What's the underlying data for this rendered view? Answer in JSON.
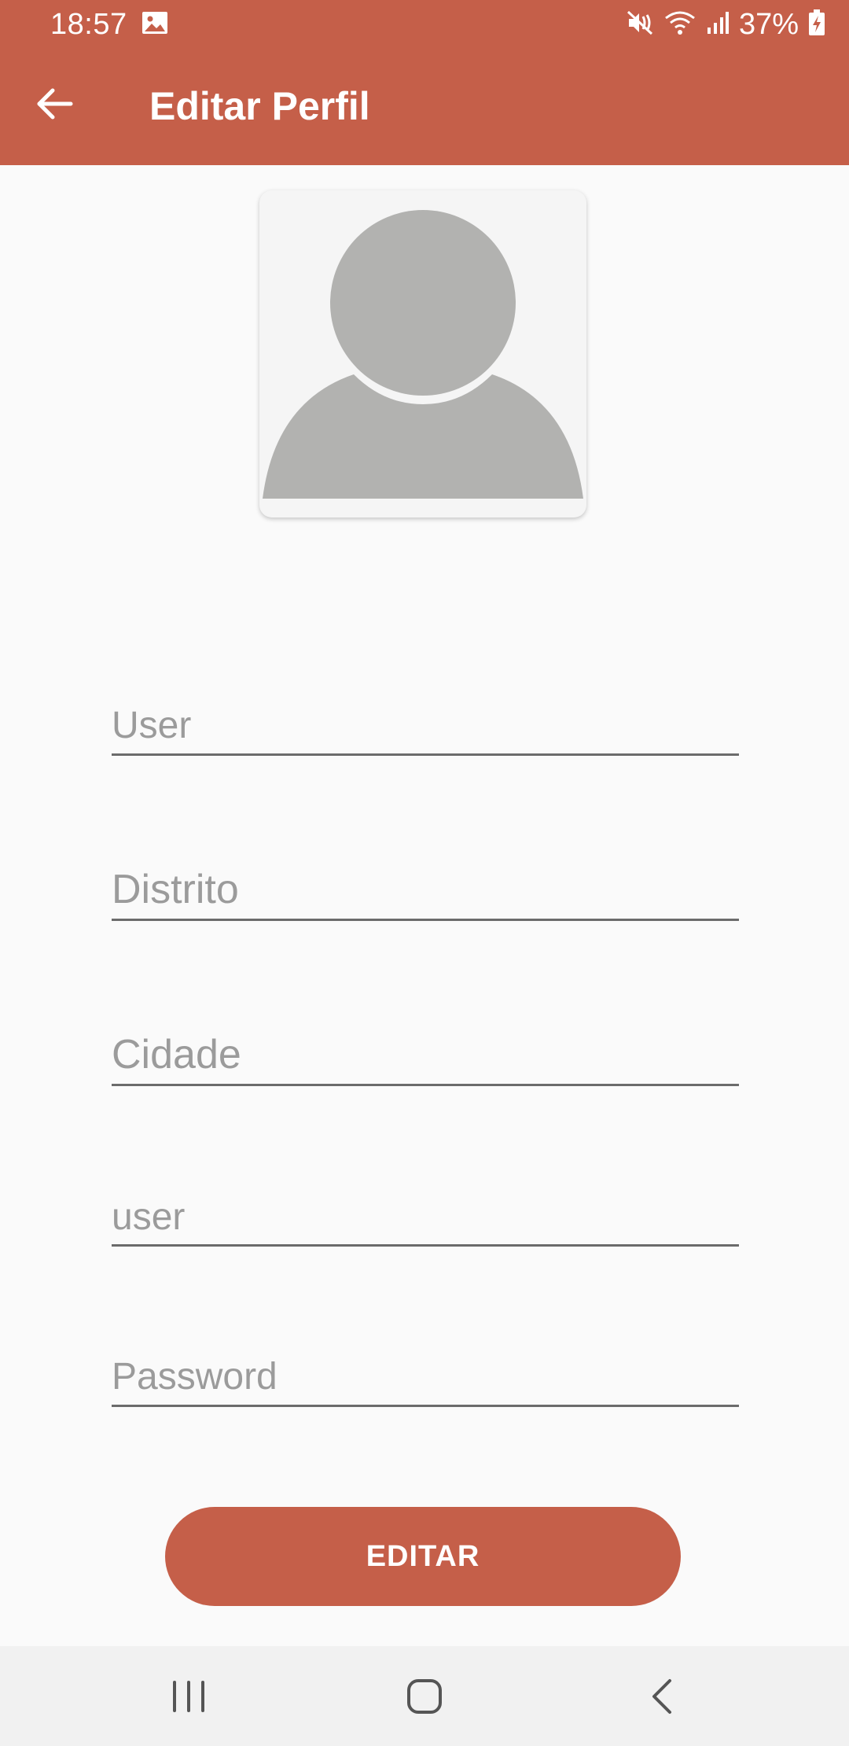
{
  "status_bar": {
    "time": "18:57",
    "battery": "37%",
    "icons": [
      "image-icon",
      "mute-vibrate-icon",
      "wifi-icon",
      "signal-icon",
      "battery-charging-icon"
    ]
  },
  "app_bar": {
    "title": "Editar Perfil",
    "back_icon": "arrow-left-icon"
  },
  "profile": {
    "avatar_icon": "person-placeholder-icon"
  },
  "form": {
    "user_placeholder": "User",
    "district_placeholder": "Distrito",
    "city_placeholder": "Cidade",
    "username_placeholder": "user",
    "password_placeholder": "Password"
  },
  "actions": {
    "edit_label": "EDITAR"
  },
  "nav_bar": {
    "icons": [
      "recents-icon",
      "home-icon",
      "back-icon"
    ]
  },
  "colors": {
    "primary": "#c55f49",
    "background": "#fafafa",
    "placeholder_text": "#9b9b9b",
    "underline": "#6b6b6b",
    "avatar_gray": "#b2b2b0"
  }
}
